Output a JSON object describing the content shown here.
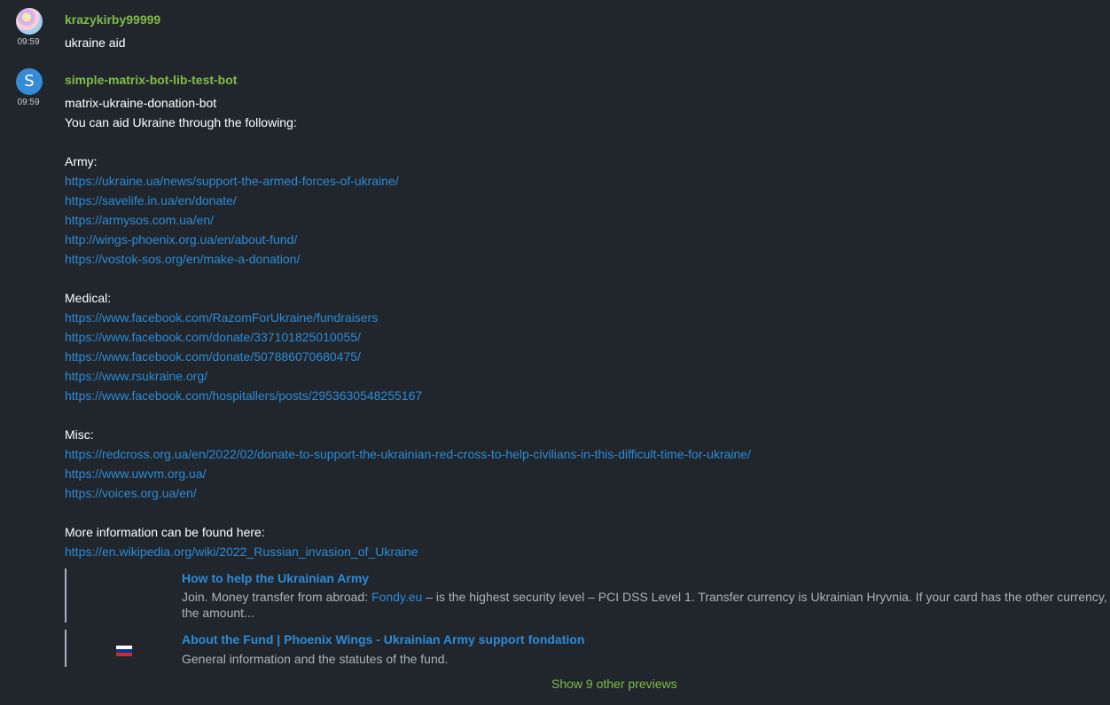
{
  "events": [
    {
      "sender": "krazykirby99999",
      "time": "09:59",
      "body": "ukraine aid",
      "avatar_icon": "user-photo-avatar"
    },
    {
      "sender": "simple-matrix-bot-lib-test-bot",
      "time": "09:59",
      "avatar_letter": "S",
      "avatar_color": "#368bd6",
      "lines": [
        "matrix-ukraine-donation-bot",
        "You can aid Ukraine through the following:",
        "",
        "Army:",
        "https://ukraine.ua/news/support-the-armed-forces-of-ukraine/",
        "https://savelife.in.ua/en/donate/",
        "https://armysos.com.ua/en/",
        "http://wings-phoenix.org.ua/en/about-fund/",
        "https://vostok-sos.org/en/make-a-donation/",
        "",
        "Medical:",
        "https://www.facebook.com/RazomForUkraine/fundraisers",
        "https://www.facebook.com/donate/337101825010055/",
        "https://www.facebook.com/donate/507886070680475/",
        "https://www.rsukraine.org/",
        "https://www.facebook.com/hospitallers/posts/2953630548255167",
        "",
        "Misc:",
        "https://redcross.org.ua/en/2022/02/donate-to-support-the-ukrainian-red-cross-to-help-civilians-in-this-difficult-time-for-ukraine/",
        "https://www.uwvm.org.ua/",
        "https://voices.org.ua/en/",
        "",
        "More information can be found here:",
        "https://en.wikipedia.org/wiki/2022_Russian_invasion_of_Ukraine"
      ],
      "previews": [
        {
          "title": "How to help the Ukrainian Army",
          "desc_before": "Join. Money transfer from abroad: ",
          "desc_link": "Fondy.eu",
          "desc_after": " – is the highest security level – PCI DSS Level 1. Transfer currency is Ukrainian Hryvnia. If your card has the other currency, the amount..."
        },
        {
          "title": "About the Fund | Phoenix Wings - Ukrainian Army support fondation",
          "desc": "General information and the statutes of the fund.",
          "icon": "russian-flag-icon"
        }
      ],
      "show_more_label": "Show 9 other previews"
    }
  ],
  "colors": {
    "background": "#21262c",
    "sender": "#7fbc48",
    "link": "#2c8bd6",
    "muted": "#a9b2bc"
  }
}
